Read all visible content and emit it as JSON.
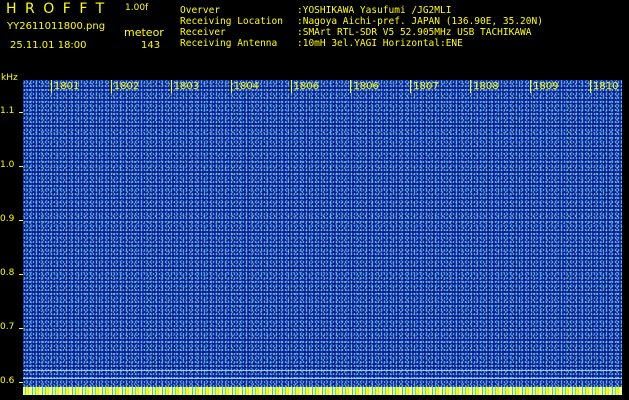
{
  "header": {
    "title": "HROFFT",
    "version": "1.00f",
    "file_name": "YY2611011800.png",
    "mode": "meteor",
    "timestamp": "25.11.01 18:00",
    "count": "143"
  },
  "info": [
    {
      "key": "Overver",
      "value": ":YOSHIKAWA Yasufumi /JG2MLI"
    },
    {
      "key": "Receiving Location",
      "value": ":Nagoya Aichi-pref. JAPAN (136.90E, 35.20N)"
    },
    {
      "key": "Receiver",
      "value": ":SMArt RTL-SDR V5 52.905MHz USB TACHIKAWA"
    },
    {
      "key": "Receiving Antenna",
      "value": ":10mH 3el.YAGI Horizontal:ENE"
    }
  ],
  "axes": {
    "y_unit": "kHz",
    "y_ticks": [
      "1.1",
      "1.0",
      "0.9",
      "0.8",
      "0.7",
      "0.6"
    ],
    "y_tick_values": [
      1.1,
      1.0,
      0.9,
      0.8,
      0.7,
      0.6
    ],
    "y_range": [
      0.575,
      1.16
    ],
    "x_ticks": [
      "1801",
      "1802",
      "1803",
      "1804",
      "1806",
      "1806",
      "1807",
      "1808",
      "1809",
      "1810"
    ],
    "x_tick_minutes": [
      1,
      2,
      3,
      4,
      5,
      6,
      7,
      8,
      9,
      10
    ],
    "x_range_minutes": [
      0,
      10
    ]
  },
  "colors": {
    "text": "#ffff00",
    "background": "#000000",
    "spectrogram_base": "#0a1f8c"
  }
}
